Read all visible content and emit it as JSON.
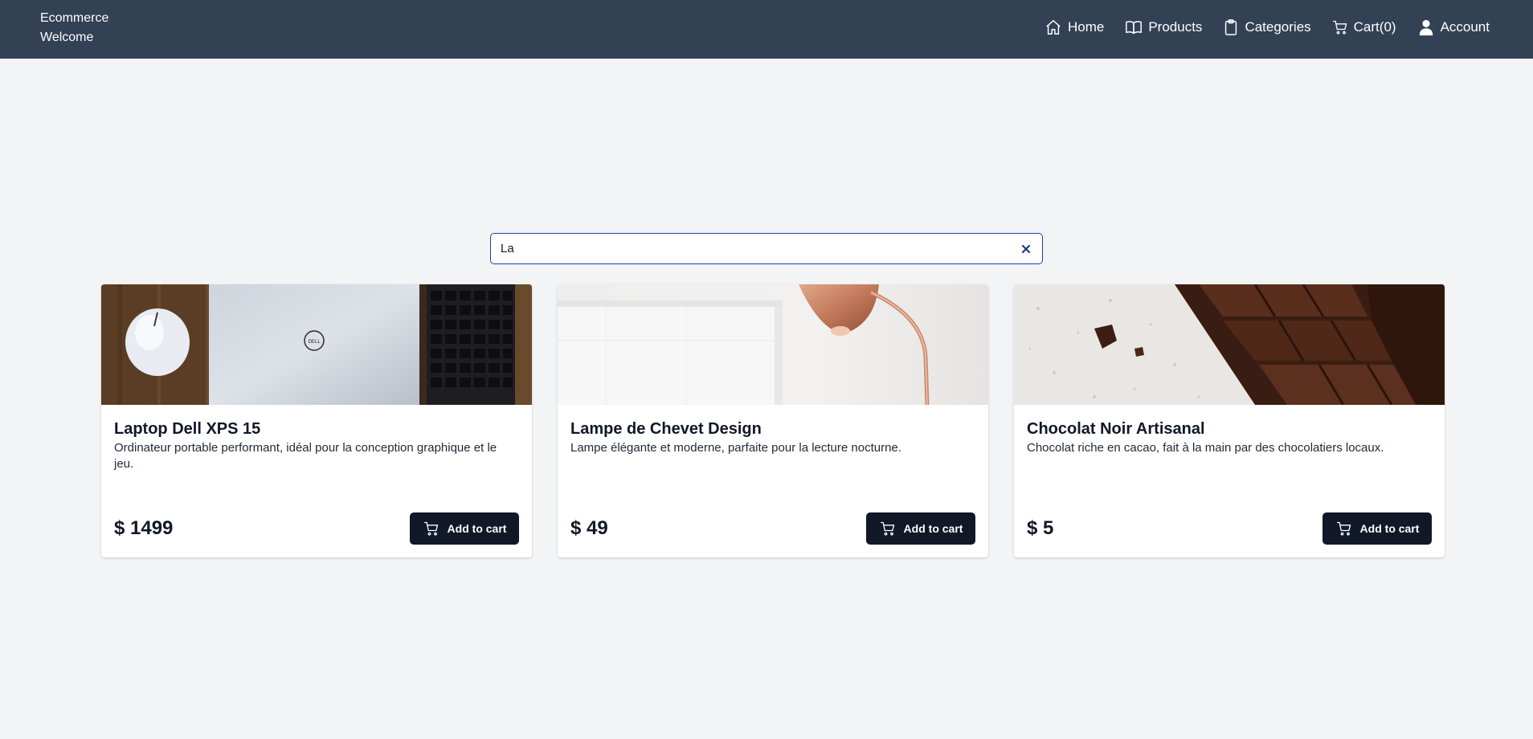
{
  "header": {
    "brand_line1": "Ecommerce",
    "brand_line2": "Welcome",
    "nav": [
      {
        "label": "Home",
        "icon": "home-icon"
      },
      {
        "label": "Products",
        "icon": "book-icon"
      },
      {
        "label": "Categories",
        "icon": "clipboard-icon"
      },
      {
        "label": "Cart",
        "count": "(0)",
        "icon": "cart-icon"
      },
      {
        "label": "Account",
        "icon": "user-icon"
      }
    ]
  },
  "search": {
    "value": "La",
    "clear_icon": "close-icon"
  },
  "products": [
    {
      "title": "Laptop Dell XPS 15",
      "description": "Ordinateur portable performant, idéal pour la conception graphique et le jeu.",
      "price": "$ 1499",
      "button": "Add to cart"
    },
    {
      "title": "Lampe de Chevet Design",
      "description": "Lampe élégante et moderne, parfaite pour la lecture nocturne.",
      "price": "$ 49",
      "button": "Add to cart"
    },
    {
      "title": "Chocolat Noir Artisanal",
      "description": "Chocolat riche en cacao, fait à la main par des chocolatiers locaux.",
      "price": "$ 5",
      "button": "Add to cart"
    }
  ],
  "colors": {
    "navbar": "#334155",
    "background": "#f3f4f6",
    "button": "#111827",
    "search_border": "#1e40af"
  }
}
